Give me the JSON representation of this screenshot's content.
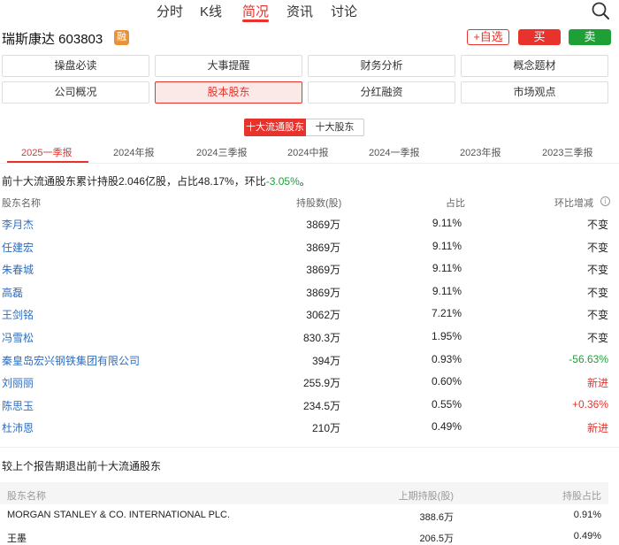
{
  "nav": {
    "tabs": [
      {
        "label": "分时"
      },
      {
        "label": "K线"
      },
      {
        "label": "简况"
      },
      {
        "label": "资讯"
      },
      {
        "label": "讨论"
      }
    ],
    "active_tab": "简况",
    "search_icon": "search-icon"
  },
  "stock": {
    "name_code": "瑞斯康达 603803",
    "badge": "融",
    "watch_label": "+自选",
    "buy_label": "买",
    "sell_label": "卖"
  },
  "menu": {
    "items": [
      {
        "label": "操盘必读"
      },
      {
        "label": "大事提醒"
      },
      {
        "label": "财务分析"
      },
      {
        "label": "概念题材"
      },
      {
        "label": "公司概况"
      },
      {
        "label": "股本股东"
      },
      {
        "label": "分红融资"
      },
      {
        "label": "市场观点"
      }
    ],
    "active": "股本股东"
  },
  "toggle": {
    "on_label": "十大流通股东",
    "off_label": "十大股东"
  },
  "periods": [
    {
      "label": "2025一季报"
    },
    {
      "label": "2024年报"
    },
    {
      "label": "2024三季报"
    },
    {
      "label": "2024中报"
    },
    {
      "label": "2024一季报"
    },
    {
      "label": "2023年报"
    },
    {
      "label": "2023三季报"
    }
  ],
  "summary": {
    "text": "前十大流通股东累计持股2.046亿股，占比48.17%，环比",
    "change": "-3.05%",
    "suffix": "。"
  },
  "table": {
    "headers": {
      "name": "股东名称",
      "shares": "持股数(股)",
      "pct": "占比",
      "change": "环比增减"
    },
    "rows": [
      {
        "name": "李月杰",
        "shares": "3869万",
        "pct": "9.11%",
        "change": "不变",
        "color": "#222222"
      },
      {
        "name": "任建宏",
        "shares": "3869万",
        "pct": "9.11%",
        "change": "不变",
        "color": "#222222"
      },
      {
        "name": "朱春城",
        "shares": "3869万",
        "pct": "9.11%",
        "change": "不变",
        "color": "#222222"
      },
      {
        "name": "高磊",
        "shares": "3869万",
        "pct": "9.11%",
        "change": "不变",
        "color": "#222222"
      },
      {
        "name": "王剑铭",
        "shares": "3062万",
        "pct": "7.21%",
        "change": "不变",
        "color": "#222222"
      },
      {
        "name": "冯雪松",
        "shares": "830.3万",
        "pct": "1.95%",
        "change": "不变",
        "color": "#222222"
      },
      {
        "name": "秦皇岛宏兴钢铁集团有限公司",
        "shares": "394万",
        "pct": "0.93%",
        "change": "-56.63%",
        "color": "#1ea037"
      },
      {
        "name": "刘丽丽",
        "shares": "255.9万",
        "pct": "0.60%",
        "change": "新进",
        "color": "#e8322c"
      },
      {
        "name": "陈思玉",
        "shares": "234.5万",
        "pct": "0.55%",
        "change": "+0.36%",
        "color": "#e8322c"
      },
      {
        "name": "杜沛恩",
        "shares": "210万",
        "pct": "0.49%",
        "change": "新进",
        "color": "#e8322c"
      }
    ]
  },
  "exit": {
    "title": "较上个报告期退出前十大流通股东",
    "headers": {
      "name": "股东名称",
      "prev": "上期持股(股)",
      "pct": "持股占比"
    },
    "rows": [
      {
        "name": "MORGAN STANLEY & CO. INTERNATIONAL PLC.",
        "prev": "388.6万",
        "pct": "0.91%"
      },
      {
        "name": "王墨",
        "prev": "206.5万",
        "pct": "0.49%"
      }
    ]
  },
  "colors": {
    "accent_red": "#e8322c",
    "green": "#1ea037",
    "link_blue": "#2f6ebd"
  }
}
